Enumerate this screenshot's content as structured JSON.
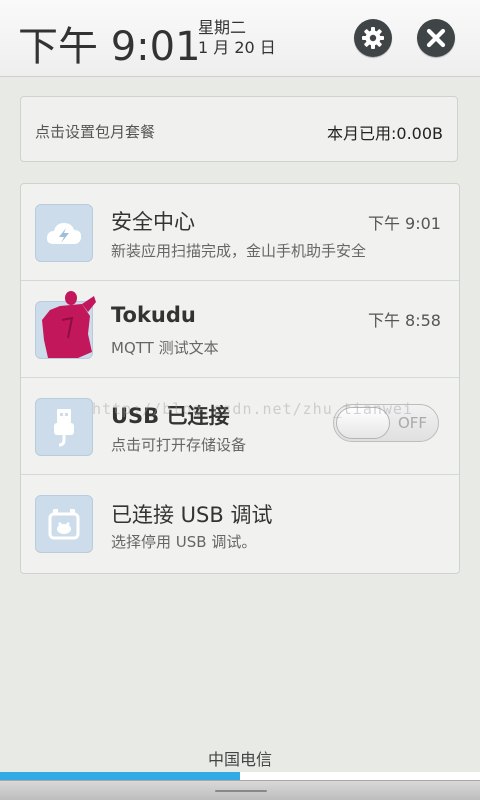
{
  "header": {
    "time": "下午 9:01",
    "weekday": "星期二",
    "date": "1 月 20 日"
  },
  "plan": {
    "setup_text": "点击设置包月套餐",
    "usage_text": "本月已用:0.00B"
  },
  "notifications": [
    {
      "icon": "cloud-lightning-icon",
      "title": "安全中心",
      "time": "下午 9:01",
      "subtitle": "新装应用扫描完成，金山手机助手安全"
    },
    {
      "icon": "avatar",
      "title": "Tokudu",
      "time": "下午 8:58",
      "subtitle": "MQTT 测试文本"
    },
    {
      "icon": "usb-icon",
      "title": "USB 已连接",
      "subtitle": "点击可打开存储设备",
      "toggle_label": "OFF"
    },
    {
      "icon": "debug-icon",
      "title": "已连接 USB 调试",
      "subtitle": "选择停用 USB 调试。"
    }
  ],
  "watermark": "http://blog.csdn.net/zhu_tianwei",
  "carrier": "中国电信",
  "progress": 0.5,
  "colors": {
    "accent": "#33aae6",
    "header_button": "#3f4547",
    "icon_bg": "#cddcea",
    "avatar": "#c2185b"
  }
}
